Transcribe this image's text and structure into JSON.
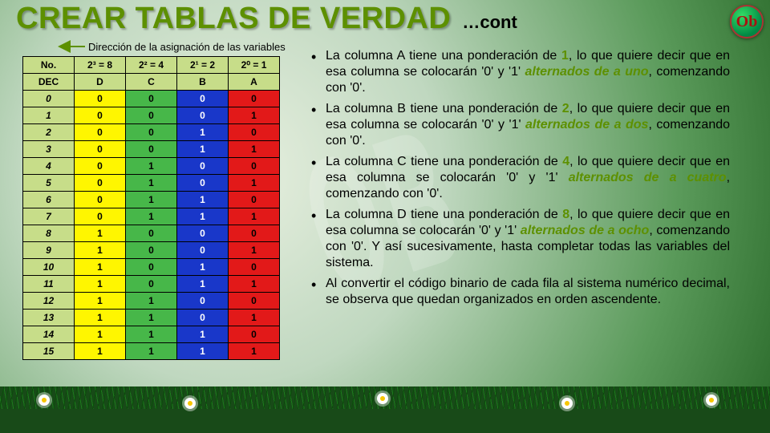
{
  "title": "CREAR TABLAS DE VERDAD",
  "title_cont": "…cont",
  "badge": "Ob",
  "arrow_caption": "Dirección de la asignación de las variables",
  "table": {
    "row1": {
      "h0": "No.",
      "h1": "2³ = 8",
      "h2": "2² = 4",
      "h3": "2¹ = 2",
      "h4": "2⁰ = 1"
    },
    "row2": {
      "h0": "DEC",
      "h1": "D",
      "h2": "C",
      "h3": "B",
      "h4": "A"
    },
    "rows": [
      {
        "n": "0",
        "d": "0",
        "c": "0",
        "b": "0",
        "a": "0"
      },
      {
        "n": "1",
        "d": "0",
        "c": "0",
        "b": "0",
        "a": "1"
      },
      {
        "n": "2",
        "d": "0",
        "c": "0",
        "b": "1",
        "a": "0"
      },
      {
        "n": "3",
        "d": "0",
        "c": "0",
        "b": "1",
        "a": "1"
      },
      {
        "n": "4",
        "d": "0",
        "c": "1",
        "b": "0",
        "a": "0"
      },
      {
        "n": "5",
        "d": "0",
        "c": "1",
        "b": "0",
        "a": "1"
      },
      {
        "n": "6",
        "d": "0",
        "c": "1",
        "b": "1",
        "a": "0"
      },
      {
        "n": "7",
        "d": "0",
        "c": "1",
        "b": "1",
        "a": "1"
      },
      {
        "n": "8",
        "d": "1",
        "c": "0",
        "b": "0",
        "a": "0"
      },
      {
        "n": "9",
        "d": "1",
        "c": "0",
        "b": "0",
        "a": "1"
      },
      {
        "n": "10",
        "d": "1",
        "c": "0",
        "b": "1",
        "a": "0"
      },
      {
        "n": "11",
        "d": "1",
        "c": "0",
        "b": "1",
        "a": "1"
      },
      {
        "n": "12",
        "d": "1",
        "c": "1",
        "b": "0",
        "a": "0"
      },
      {
        "n": "13",
        "d": "1",
        "c": "1",
        "b": "0",
        "a": "1"
      },
      {
        "n": "14",
        "d": "1",
        "c": "1",
        "b": "1",
        "a": "0"
      },
      {
        "n": "15",
        "d": "1",
        "c": "1",
        "b": "1",
        "a": "1"
      }
    ]
  },
  "bullets": {
    "b1": {
      "t1": "La columna A tiene una ponderación de ",
      "n": "1",
      "t2": ", lo que quiere decir que en esa columna se colocarán '0' y '1' ",
      "alt": "alternados de a uno",
      "t3": ", comenzando con '0'."
    },
    "b2": {
      "t1": "La columna B tiene una ponderación de ",
      "n": "2",
      "t2": ", lo que quiere decir que en esa columna se colocarán '0' y '1' ",
      "alt": "alternados de a dos",
      "t3": ", comenzando con '0'."
    },
    "b3": {
      "t1": "La columna C tiene una ponderación de ",
      "n": "4",
      "t2": ", lo que quiere decir que en esa columna se colocarán '0' y '1' ",
      "alt": "alternados de a cuatro",
      "t3": ", comenzando con '0'."
    },
    "b4": {
      "t1": "La columna D tiene una ponderación de ",
      "n": "8",
      "t2": ", lo que quiere decir que en esa columna se colocarán '0' y '1' ",
      "alt": "alternados de a ocho",
      "t3": ", comenzando con '0'. Y así sucesivamente, hasta completar todas las variables del sistema."
    },
    "b5": {
      "t": "Al convertir el código binario de cada fila al sistema numérico decimal, se observa que quedan organizados en orden ascendente."
    }
  },
  "watermark": "OB"
}
